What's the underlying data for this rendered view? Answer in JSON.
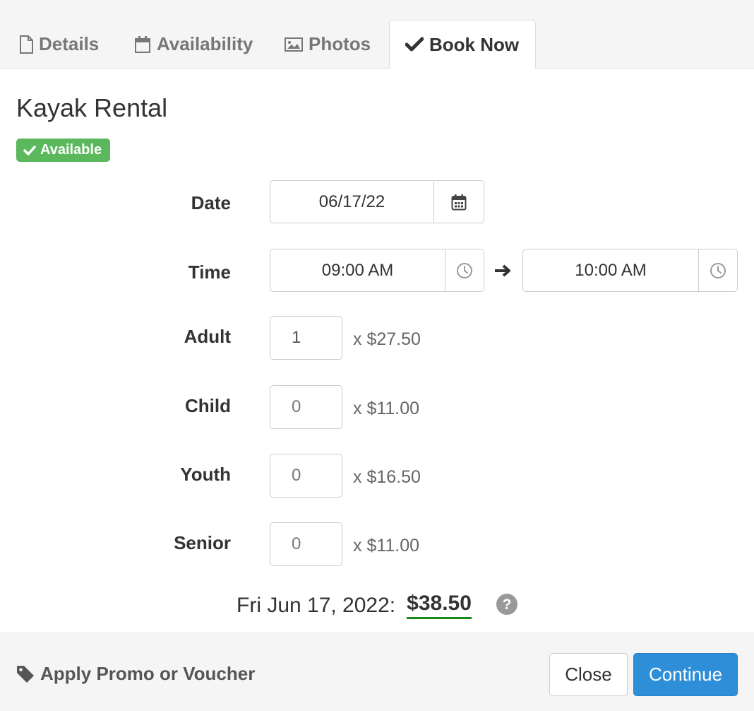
{
  "tabs": [
    {
      "label": "Details",
      "icon": "file-icon"
    },
    {
      "label": "Availability",
      "icon": "calendar-icon"
    },
    {
      "label": "Photos",
      "icon": "image-icon"
    },
    {
      "label": "Book Now",
      "icon": "check-icon",
      "active": true
    }
  ],
  "title": "Kayak Rental",
  "status_badge": "Available",
  "form": {
    "date_label": "Date",
    "date_value": "06/17/22",
    "time_label": "Time",
    "start_time": "09:00 AM",
    "end_time": "10:00 AM",
    "rows": [
      {
        "label": "Adult",
        "qty": "1",
        "price": "x $27.50"
      },
      {
        "label": "Child",
        "qty": "0",
        "price": "x $11.00"
      },
      {
        "label": "Youth",
        "qty": "0",
        "price": "x $16.50"
      },
      {
        "label": "Senior",
        "qty": "0",
        "price": "x $11.00"
      }
    ]
  },
  "summary": {
    "date_text": "Fri Jun 17, 2022:",
    "total": "$38.50"
  },
  "footer": {
    "promo_label": "Apply Promo or Voucher",
    "close_label": "Close",
    "continue_label": "Continue"
  },
  "colors": {
    "badge": "#5cb85c",
    "primary": "#2e8fd8",
    "total_underline": "#1a8a1a"
  }
}
